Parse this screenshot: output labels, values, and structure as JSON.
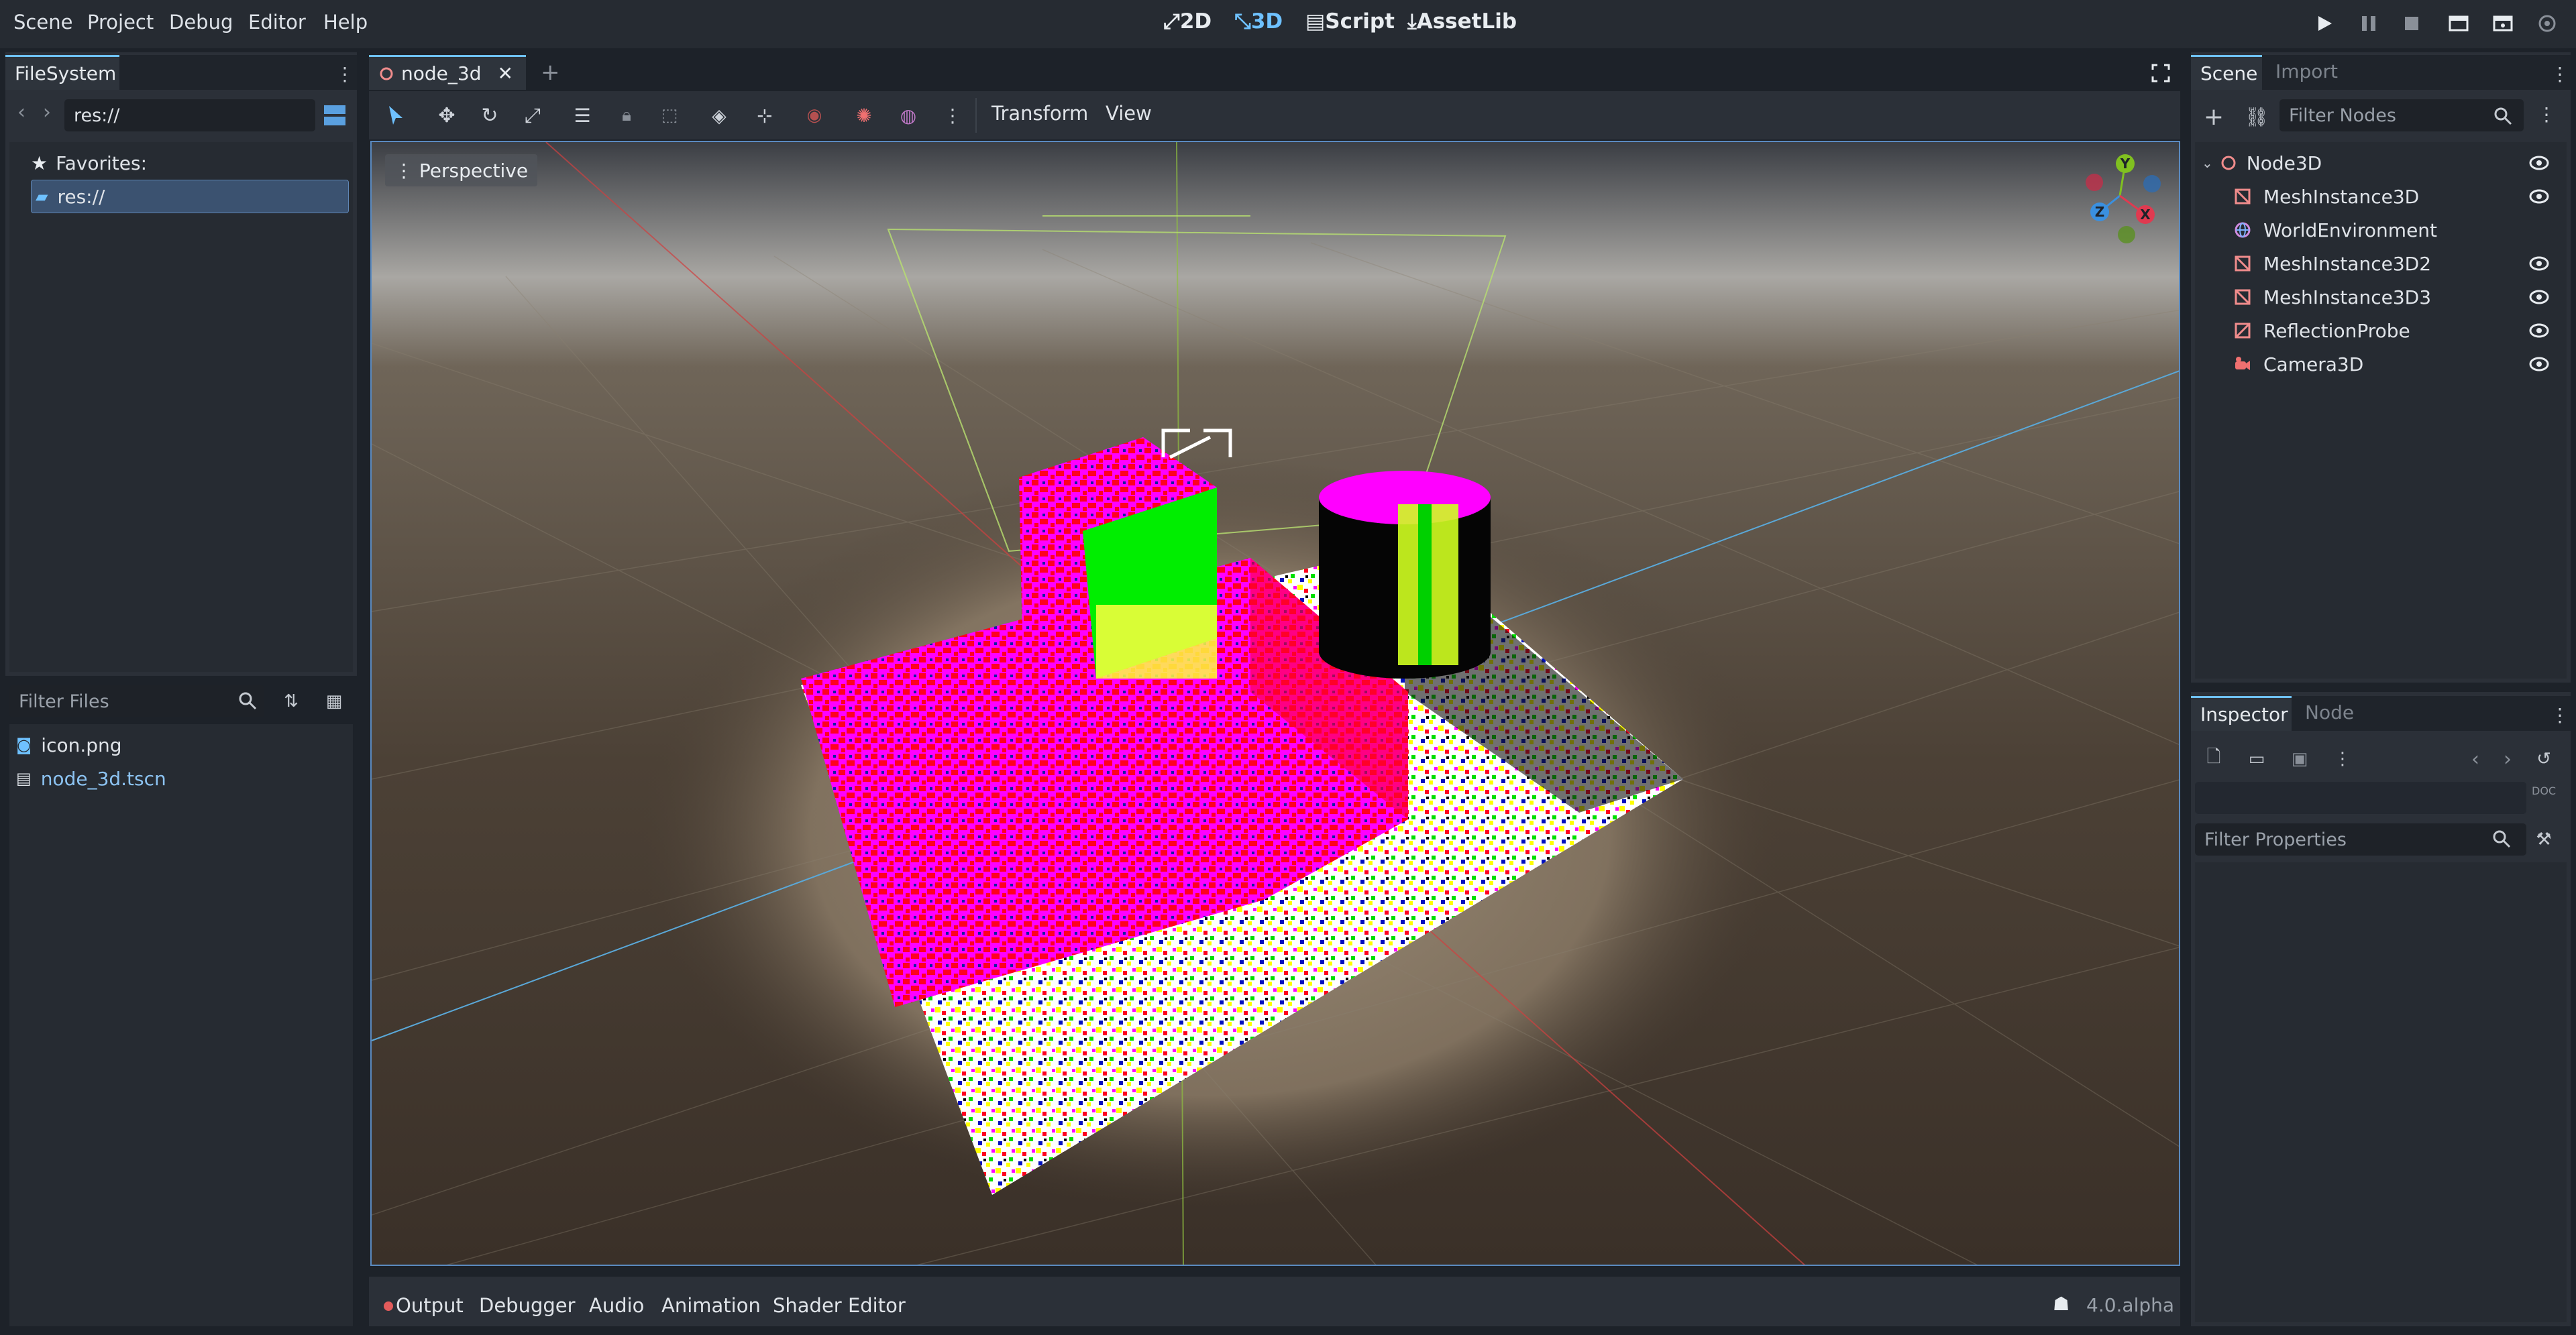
{
  "menu": {
    "items": [
      "Scene",
      "Project",
      "Debug",
      "Editor",
      "Help"
    ]
  },
  "modes": {
    "m2d": "2D",
    "m3d": "3D",
    "script": "Script",
    "assetlib": "AssetLib"
  },
  "filesystem": {
    "tab": "FileSystem",
    "path": "res://",
    "favorites": "Favorites:",
    "root": "res://",
    "filter_placeholder": "Filter Files",
    "files": [
      {
        "name": "icon.png",
        "icon": "image-icon"
      },
      {
        "name": "node_3d.tscn",
        "icon": "scene-icon"
      }
    ]
  },
  "editor": {
    "scene_tab": "node_3d",
    "transform": "Transform",
    "view": "View"
  },
  "viewport": {
    "perspective": "Perspective",
    "gizmo": {
      "y": "Y",
      "x": "X",
      "z": "Z"
    }
  },
  "scene_dock": {
    "tab_scene": "Scene",
    "tab_import": "Import",
    "filter_placeholder": "Filter Nodes",
    "nodes": [
      {
        "name": "Node3D",
        "icon": "node3d-icon",
        "eye": true
      },
      {
        "name": "MeshInstance3D",
        "icon": "mesh-icon",
        "eye": true
      },
      {
        "name": "WorldEnvironment",
        "icon": "world-icon",
        "eye": false
      },
      {
        "name": "MeshInstance3D2",
        "icon": "mesh-icon",
        "eye": true
      },
      {
        "name": "MeshInstance3D3",
        "icon": "mesh-icon",
        "eye": true
      },
      {
        "name": "ReflectionProbe",
        "icon": "probe-icon",
        "eye": true
      },
      {
        "name": "Camera3D",
        "icon": "camera-icon",
        "eye": true
      }
    ]
  },
  "inspector": {
    "tab_inspector": "Inspector",
    "tab_node": "Node",
    "filter_placeholder": "Filter Properties",
    "doc": "DOC"
  },
  "bottom": {
    "tabs": [
      "Output",
      "Debugger",
      "Audio",
      "Animation",
      "Shader Editor"
    ],
    "version": "4.0.alpha"
  },
  "colors": {
    "accent": "#6ec1ff",
    "bg": "#1d2229",
    "panel": "#2b3038",
    "error": "#e35b5b"
  }
}
